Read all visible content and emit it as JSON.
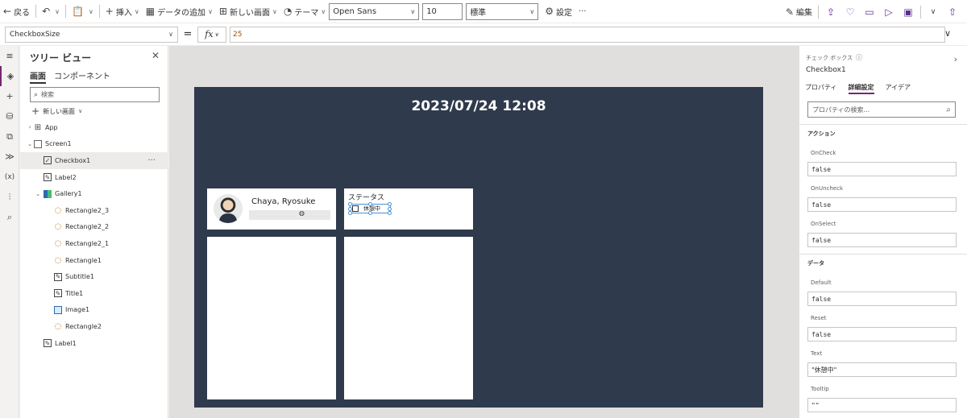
{
  "toolbar": {
    "back": "戻る",
    "insert": "挿入",
    "add_data": "データの追加",
    "new_screen": "新しい画面",
    "theme": "テーマ",
    "font": "Open Sans",
    "font_size": "10",
    "style": "標準",
    "settings": "設定",
    "more": "···",
    "edit": "編集"
  },
  "formula": {
    "property": "CheckboxSize",
    "equals": "=",
    "fx": "fx",
    "value": "25"
  },
  "tree": {
    "title": "ツリー ビュー",
    "tabs": [
      "画面",
      "コンポーネント"
    ],
    "search_placeholder": "検索",
    "new_screen": "新しい画面",
    "items": [
      {
        "label": "App"
      },
      {
        "label": "Screen1"
      },
      {
        "label": "Checkbox1"
      },
      {
        "label": "Label2"
      },
      {
        "label": "Gallery1"
      },
      {
        "label": "Rectangle2_3"
      },
      {
        "label": "Rectangle2_2"
      },
      {
        "label": "Rectangle2_1"
      },
      {
        "label": "Rectangle1"
      },
      {
        "label": "Subtitle1"
      },
      {
        "label": "Title1"
      },
      {
        "label": "Image1"
      },
      {
        "label": "Rectangle2"
      },
      {
        "label": "Label1"
      }
    ],
    "selected_more": "···"
  },
  "canvas": {
    "timestamp": "2023/07/24 12:08",
    "user_name": "Chaya, Ryosuke",
    "status_label": "ステータス",
    "checkbox_text": "休憩中",
    "colors": {
      "screen_bg": "#2f3a4c",
      "card_bg": "#ffffff",
      "selection": "#4a90d9"
    }
  },
  "props": {
    "control_type": "チェック ボックス",
    "control_name": "Checkbox1",
    "tabs": [
      "プロパティ",
      "詳細設定",
      "アイデア"
    ],
    "search_placeholder": "プロパティの検索...",
    "sections": {
      "action": "アクション",
      "data": "データ"
    },
    "fields": {
      "oncheck_label": "OnCheck",
      "oncheck_value": "false",
      "onuncheck_label": "OnUncheck",
      "onuncheck_value": "false",
      "onselect_label": "OnSelect",
      "onselect_value": "false",
      "default_label": "Default",
      "default_value": "false",
      "reset_label": "Reset",
      "reset_value": "false",
      "text_label": "Text",
      "text_value": "\"休憩中\"",
      "tooltip_label": "Tooltip",
      "tooltip_value": "\"\""
    }
  }
}
